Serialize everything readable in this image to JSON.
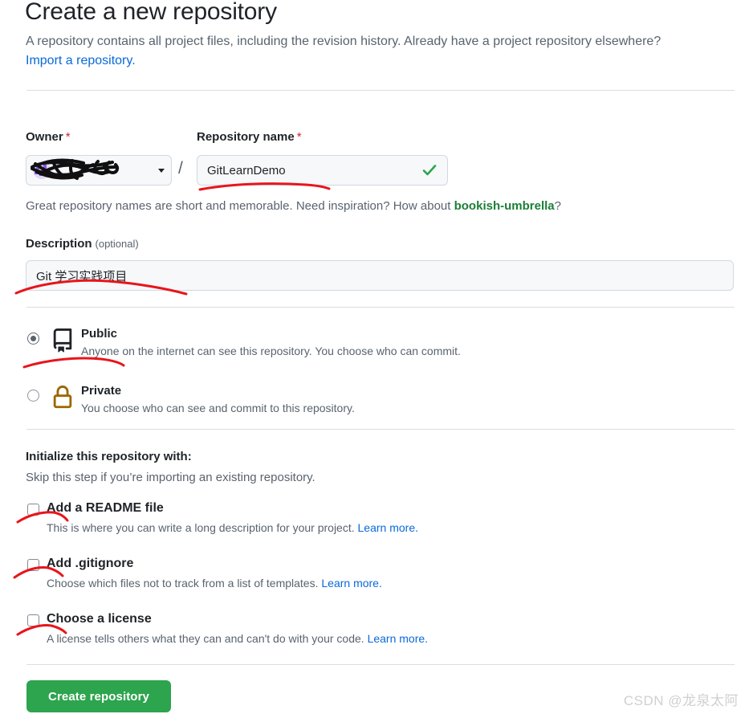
{
  "header": {
    "title": "Create a new repository",
    "description_part1": "A repository contains all project files, including the revision history. Already have a project repository elsewhere?",
    "import_link": "Import a repository."
  },
  "owner": {
    "label": "Owner",
    "required_marker": "*",
    "name_redacted": "",
    "avatar_icon": "user-identicon-avatar",
    "dropdown_icon": "chevron-down-icon",
    "separator": "/"
  },
  "repository_name": {
    "label": "Repository name",
    "required_marker": "*",
    "value": "GitLearnDemo",
    "validation_icon": "check-icon",
    "validation_color": "#2da44e"
  },
  "name_hint": {
    "text_before": "Great repository names are short and memorable. Need inspiration? How about ",
    "suggestion": "bookish-umbrella",
    "text_after": "?"
  },
  "description": {
    "label": "Description",
    "optional_marker": "(optional)",
    "value": "Git 学习实践项目"
  },
  "visibility": {
    "options": [
      {
        "id": "public",
        "title": "Public",
        "description": "Anyone on the internet can see this repository. You choose who can commit.",
        "icon": "repo-book-icon",
        "icon_color": "#1f2328",
        "selected": true
      },
      {
        "id": "private",
        "title": "Private",
        "description": "You choose who can see and commit to this repository.",
        "icon": "lock-icon",
        "icon_color": "#9a6700",
        "selected": false
      }
    ]
  },
  "initialize": {
    "title": "Initialize this repository with:",
    "subtitle": "Skip this step if you’re importing an existing repository.",
    "items": [
      {
        "id": "readme",
        "title": "Add a README file",
        "description": "This is where you can write a long description for your project. ",
        "link": "Learn more.",
        "checked": false
      },
      {
        "id": "gitignore",
        "title": "Add .gitignore",
        "description": "Choose which files not to track from a list of templates. ",
        "link": "Learn more.",
        "checked": false
      },
      {
        "id": "license",
        "title": "Choose a license",
        "description": "A license tells others what they can and can't do with your code. ",
        "link": "Learn more.",
        "checked": false
      }
    ]
  },
  "footer": {
    "create_button": "Create repository",
    "watermark": "CSDN @龙泉太阿"
  },
  "colors": {
    "accent_green": "#2da44e",
    "link_blue": "#0969da",
    "suggest_green": "#1a7f37",
    "required_red": "#cf222e",
    "lock_gold": "#9a6700",
    "annotation_red": "#e8151b",
    "muted_text": "#59636e",
    "border": "#d1d9e0"
  }
}
